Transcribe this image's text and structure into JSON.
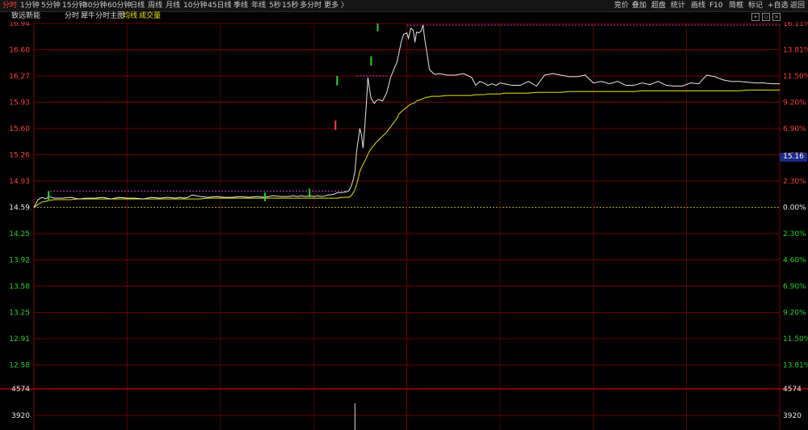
{
  "toolbar": {
    "left": [
      "分时",
      "1分钟",
      "5分钟",
      "15分钟",
      "30分钟",
      "60分钟",
      "日线",
      "周线",
      "月线",
      "10分钟",
      "45日线",
      "季线",
      "年线",
      "5秒",
      "15秒",
      "多分时",
      "更多 〉"
    ],
    "right": [
      "竞价",
      "叠加",
      "超盘",
      "统计",
      "画线",
      "F10",
      "简框",
      "标记",
      "+自选",
      "返回"
    ]
  },
  "sub": {
    "stock": "致远新能",
    "mode": "分时",
    "indicator": "犀牛分时主图",
    "avg_label": "均线",
    "vol_label": "成交量"
  },
  "colors": {
    "up": "#ff3b3b",
    "down": "#2bd02b",
    "price": "#e8e8e8",
    "avg": "#e8e800",
    "grid": "#6a0000",
    "dash": "#c83cc8"
  },
  "current_price_badge": "15.16",
  "chart_data": {
    "type": "line",
    "prev_close": 14.59,
    "y_ticks_left": [
      "16.94",
      "16.60",
      "16.27",
      "15.93",
      "15.60",
      "15.26",
      "14.93",
      "14.59",
      "14.25",
      "13.92",
      "13.58",
      "13.25",
      "12.91",
      "12.58"
    ],
    "y_ticks_right": [
      "16.11%",
      "13.81%",
      "11.50%",
      "9.20%",
      "6.90%",
      "4.60%",
      "2.30%",
      "0.00%",
      "2.30%",
      "4.60%",
      "6.90%",
      "9.20%",
      "11.50%",
      "13.81%"
    ],
    "ylim": [
      12.58,
      16.94
    ],
    "volume_ticks": [
      "4574",
      "3920"
    ],
    "x": [
      0,
      5,
      10,
      15,
      18,
      25,
      35,
      45,
      55,
      65,
      75,
      85,
      95,
      105,
      115,
      125,
      135,
      145,
      155,
      165,
      175,
      180,
      185,
      190,
      195,
      205,
      215,
      225,
      235,
      245,
      255,
      265,
      275,
      285,
      295,
      305,
      315,
      320,
      325,
      330,
      335,
      340,
      345,
      350,
      355,
      360,
      362,
      365,
      370,
      375,
      380,
      385,
      388,
      390,
      392,
      394,
      396,
      398,
      400,
      402,
      404,
      406,
      408,
      410,
      412,
      414,
      416,
      418,
      420,
      422,
      425,
      430,
      435,
      440,
      445,
      448,
      450,
      453,
      456,
      460,
      462,
      465,
      468,
      470,
      472,
      475,
      478,
      480,
      482,
      485,
      488,
      490,
      493,
      495,
      500,
      510,
      520,
      530,
      540,
      545,
      550,
      555,
      560,
      565,
      570,
      575,
      580,
      590,
      600,
      610,
      620,
      630,
      640,
      650,
      660,
      670,
      680,
      690,
      700,
      710,
      720,
      730,
      740,
      750,
      760,
      770,
      780,
      790,
      800,
      810,
      820,
      830,
      840,
      850,
      860,
      870,
      880,
      890,
      900,
      910,
      920
    ],
    "price": [
      14.59,
      14.69,
      14.72,
      14.7,
      14.73,
      14.71,
      14.71,
      14.72,
      14.7,
      14.71,
      14.71,
      14.72,
      14.7,
      14.72,
      14.71,
      14.71,
      14.7,
      14.72,
      14.71,
      14.72,
      14.71,
      14.72,
      14.71,
      14.72,
      14.75,
      14.73,
      14.72,
      14.73,
      14.72,
      14.72,
      14.73,
      14.72,
      14.73,
      14.72,
      14.74,
      14.73,
      14.73,
      14.74,
      14.73,
      14.74,
      14.73,
      14.74,
      14.73,
      14.74,
      14.73,
      14.74,
      14.75,
      14.75,
      14.76,
      14.78,
      14.78,
      14.79,
      14.8,
      14.83,
      14.88,
      14.95,
      15.05,
      15.3,
      15.45,
      15.6,
      15.52,
      15.35,
      15.6,
      15.9,
      16.25,
      16.1,
      15.98,
      15.95,
      15.92,
      15.95,
      15.97,
      15.95,
      16.05,
      16.25,
      16.38,
      16.45,
      16.55,
      16.7,
      16.8,
      16.82,
      16.75,
      16.88,
      16.85,
      16.7,
      16.83,
      16.82,
      16.85,
      16.92,
      16.75,
      16.55,
      16.35,
      16.33,
      16.3,
      16.29,
      16.3,
      16.28,
      16.28,
      16.3,
      16.25,
      16.15,
      16.2,
      16.18,
      16.15,
      16.17,
      16.15,
      16.18,
      16.17,
      16.15,
      16.15,
      16.2,
      16.14,
      16.28,
      16.3,
      16.28,
      16.26,
      16.26,
      16.28,
      16.18,
      16.2,
      16.17,
      16.2,
      16.15,
      16.15,
      16.18,
      16.16,
      16.2,
      16.15,
      16.14,
      16.14,
      16.18,
      16.17,
      16.28,
      16.26,
      16.22,
      16.2,
      16.2,
      16.19,
      16.18,
      16.18,
      16.17,
      16.17
    ],
    "avg": [
      14.59,
      14.63,
      14.66,
      14.67,
      14.68,
      14.69,
      14.69,
      14.69,
      14.7,
      14.7,
      14.7,
      14.7,
      14.7,
      14.7,
      14.7,
      14.7,
      14.7,
      14.7,
      14.7,
      14.7,
      14.7,
      14.7,
      14.7,
      14.7,
      14.7,
      14.7,
      14.71,
      14.71,
      14.71,
      14.71,
      14.71,
      14.71,
      14.71,
      14.71,
      14.71,
      14.71,
      14.71,
      14.71,
      14.71,
      14.71,
      14.71,
      14.71,
      14.71,
      14.71,
      14.71,
      14.71,
      14.71,
      14.71,
      14.71,
      14.71,
      14.72,
      14.72,
      14.72,
      14.73,
      14.75,
      14.78,
      14.82,
      14.88,
      14.96,
      15.05,
      15.1,
      15.14,
      15.18,
      15.22,
      15.27,
      15.31,
      15.34,
      15.37,
      15.39,
      15.42,
      15.45,
      15.5,
      15.55,
      15.62,
      15.69,
      15.73,
      15.78,
      15.81,
      15.84,
      15.87,
      15.89,
      15.91,
      15.92,
      15.93,
      15.95,
      15.96,
      15.97,
      15.98,
      15.99,
      16.0,
      16.0,
      16.01,
      16.01,
      16.01,
      16.01,
      16.02,
      16.02,
      16.02,
      16.02,
      16.03,
      16.03,
      16.03,
      16.04,
      16.04,
      16.04,
      16.04,
      16.05,
      16.05,
      16.05,
      16.05,
      16.06,
      16.06,
      16.06,
      16.06,
      16.07,
      16.07,
      16.07,
      16.07,
      16.07,
      16.07,
      16.07,
      16.07,
      16.07,
      16.08,
      16.08,
      16.08,
      16.08,
      16.08,
      16.08,
      16.08,
      16.08,
      16.08,
      16.08,
      16.08,
      16.08,
      16.08,
      16.09,
      16.09,
      16.09,
      16.09,
      16.09,
      16.09,
      16.09
    ],
    "vol_spike_label": null
  }
}
